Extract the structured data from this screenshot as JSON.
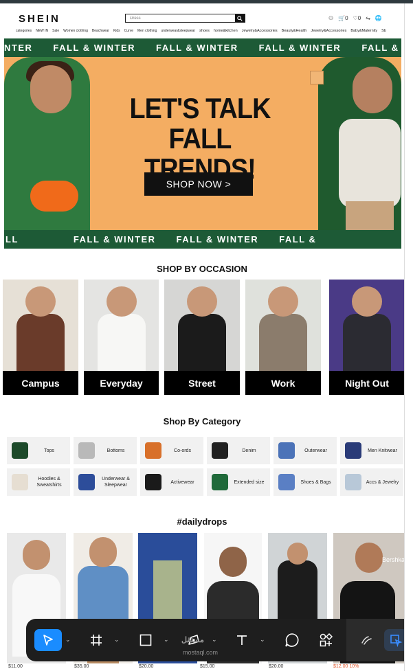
{
  "header": {
    "logo": "SHEIN",
    "search_placeholder": "Dress",
    "icons": [
      "user-icon",
      "cart-icon",
      "heart-icon",
      "share-icon",
      "globe-icon"
    ],
    "cart_count": "0",
    "wish_count": "0",
    "categories": [
      "categories",
      "NEW IN",
      "Sale",
      "Women clothing",
      "Beachwear",
      "Kids",
      "Curve",
      "Men clothing",
      "underwear&sleepwear",
      "shoes",
      "home&kitchen",
      "Jewelry&Accessories",
      "Beauty&Health",
      "Jewelry&Accessories",
      "Baby&Maternity",
      "Sb"
    ]
  },
  "banner": {
    "ribbon_text": "FALL & WINTER",
    "ribbon_top_lead": "NTER",
    "ribbon_bottom_lead": "LL",
    "ribbon_bottom_tail": "FALL &",
    "headline_line1": "LET'S TALK",
    "headline_line2": "FALL TRENDS!",
    "cta": "SHOP NOW >"
  },
  "occasion": {
    "title": "SHOP BY OCCASION",
    "items": [
      "Campus",
      "Everyday",
      "Street",
      "Work",
      "Night Out"
    ]
  },
  "category": {
    "title": "Shop By Category",
    "items": [
      "Tops",
      "Bottoms",
      "Co-ords",
      "Denim",
      "Outerwear",
      "Men Knitwear",
      "Hoodies & Sweatshirts",
      "Underwear & Sleepwear",
      "Activewear",
      "Extended size",
      "Shoes & Bags",
      "Accs & Jewelry"
    ]
  },
  "drops": {
    "title": "#dailydrops",
    "prices": [
      "$11.00",
      "$35.00",
      "$20.00",
      "$15.00",
      "$20.00",
      "$12.00 10%"
    ],
    "brand_tag": "Bershka"
  },
  "toolbar": {
    "tools": [
      "move-tool-icon",
      "frame-tool-icon",
      "shape-tool-icon",
      "pen-tool-icon",
      "text-tool-icon",
      "comment-tool-icon",
      "resources-tool-icon",
      "draw-tool-icon",
      "dev-mode-icon"
    ],
    "watermark": "مستقل",
    "watermark_url": "mostaql.com"
  },
  "colors": {
    "banner_bg": "#f4ad62",
    "ribbon": "#1d5a36",
    "active_tool": "#1a8cff",
    "toolbar_bg": "#1e1e1e"
  }
}
